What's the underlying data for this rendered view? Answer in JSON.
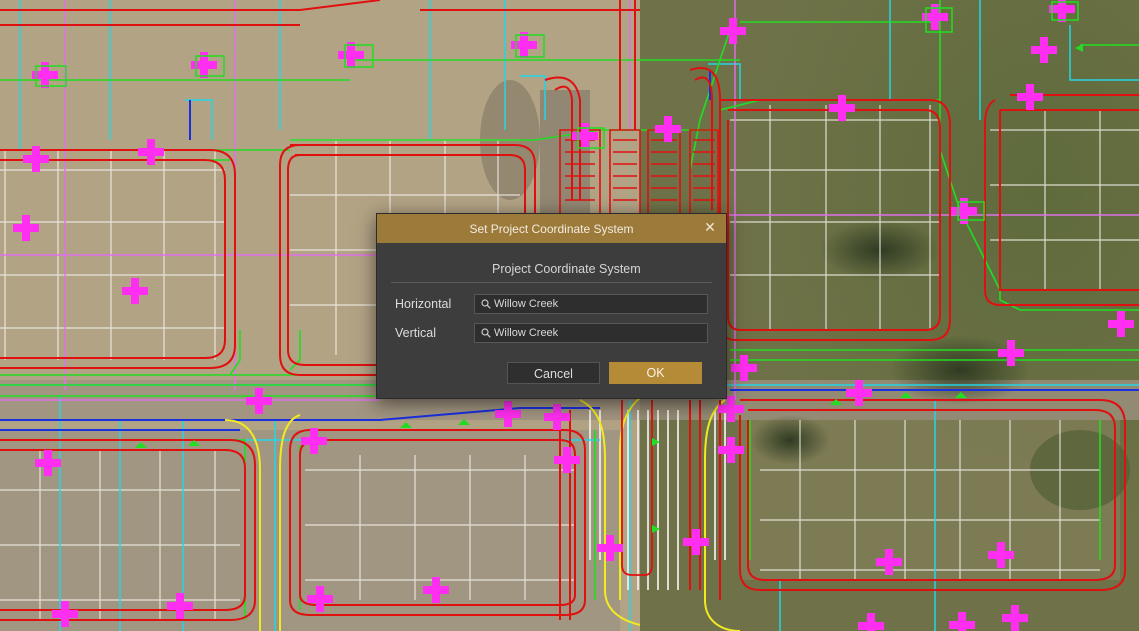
{
  "dialog": {
    "title": "Set Project Coordinate System",
    "close_glyph": "✕",
    "section_title": "Project Coordinate System",
    "horizontal": {
      "label": "Horizontal",
      "value": "Willow Creek"
    },
    "vertical": {
      "label": "Vertical",
      "value": "Willow Creek"
    },
    "cancel_label": "Cancel",
    "ok_label": "OK"
  },
  "icons": {
    "search": "search-icon",
    "close": "close-icon"
  },
  "colors": {
    "titlebar": "#9c7a3a",
    "ok_button": "#b58b38",
    "dialog_bg": "#3d3d3d",
    "curb_red": "#e01010",
    "edge_green": "#22dd22",
    "line_cyan": "#22d6e6",
    "line_magenta": "#e070e8",
    "marker_magenta": "#ff2ef0",
    "line_yellow": "#f2ea20",
    "line_blue": "#1a2fe0"
  }
}
